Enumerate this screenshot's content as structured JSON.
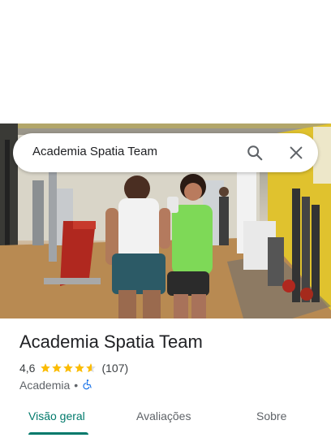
{
  "search": {
    "query": "Academia Spatia Team"
  },
  "place": {
    "name": "Academia Spatia Team",
    "rating": "4,6",
    "rating_value": 4.6,
    "rating_max": 5,
    "review_count": "(107)",
    "category": "Academia",
    "separator": "•",
    "accessible_icon": "wheelchair-icon"
  },
  "tabs": [
    {
      "label": "Visão geral",
      "active": true
    },
    {
      "label": "Avaliações",
      "active": false
    },
    {
      "label": "Sobre",
      "active": false
    }
  ],
  "colors": {
    "accent": "#00796b",
    "star": "#fbbc04",
    "accessible_icon": "#1a73e8"
  }
}
